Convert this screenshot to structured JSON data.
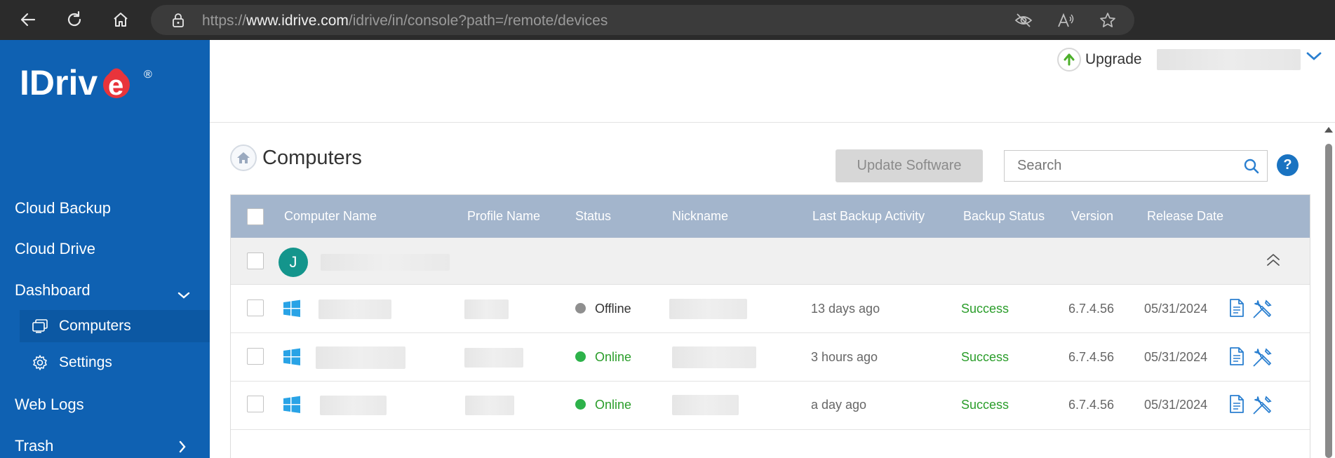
{
  "browser": {
    "url_prefix": "https://",
    "url_domain": "www.idrive.com",
    "url_path": "/idrive/in/console?path=/remote/devices"
  },
  "sidebar": {
    "logo_text": "IDrive",
    "logo_mark": "®",
    "items": [
      {
        "label": "Cloud Backup"
      },
      {
        "label": "Cloud Drive"
      },
      {
        "label": "Dashboard"
      },
      {
        "label": "Web Logs"
      },
      {
        "label": "Trash"
      }
    ],
    "sub_items": [
      {
        "label": "Computers",
        "icon": "computers-icon",
        "active": true
      },
      {
        "label": "Settings",
        "icon": "gear-icon",
        "active": false
      }
    ]
  },
  "header": {
    "upgrade_label": "Upgrade"
  },
  "main": {
    "title": "Computers",
    "update_button": "Update Software",
    "search_placeholder": "Search",
    "help_label": "?"
  },
  "table": {
    "columns": [
      "Computer Name",
      "Profile Name",
      "Status",
      "Nickname",
      "Last Backup Activity",
      "Backup Status",
      "Version",
      "Release Date"
    ],
    "group": {
      "avatar_letter": "J"
    },
    "rows": [
      {
        "status": "Offline",
        "last_backup": "13 days ago",
        "backup_status": "Success",
        "version": "6.7.4.56",
        "release_date": "05/31/2024"
      },
      {
        "status": "Online",
        "last_backup": "3 hours ago",
        "backup_status": "Success",
        "version": "6.7.4.56",
        "release_date": "05/31/2024"
      },
      {
        "status": "Online",
        "last_backup": "a day ago",
        "backup_status": "Success",
        "version": "6.7.4.56",
        "release_date": "05/31/2024"
      }
    ]
  },
  "colors": {
    "sidebar_bg": "#0f61b2",
    "table_header_bg": "#a3b5cc",
    "online": "#2db24a",
    "offline": "#8f8f8f",
    "success": "#2a9d2a",
    "accent_blue": "#1a73c1"
  }
}
